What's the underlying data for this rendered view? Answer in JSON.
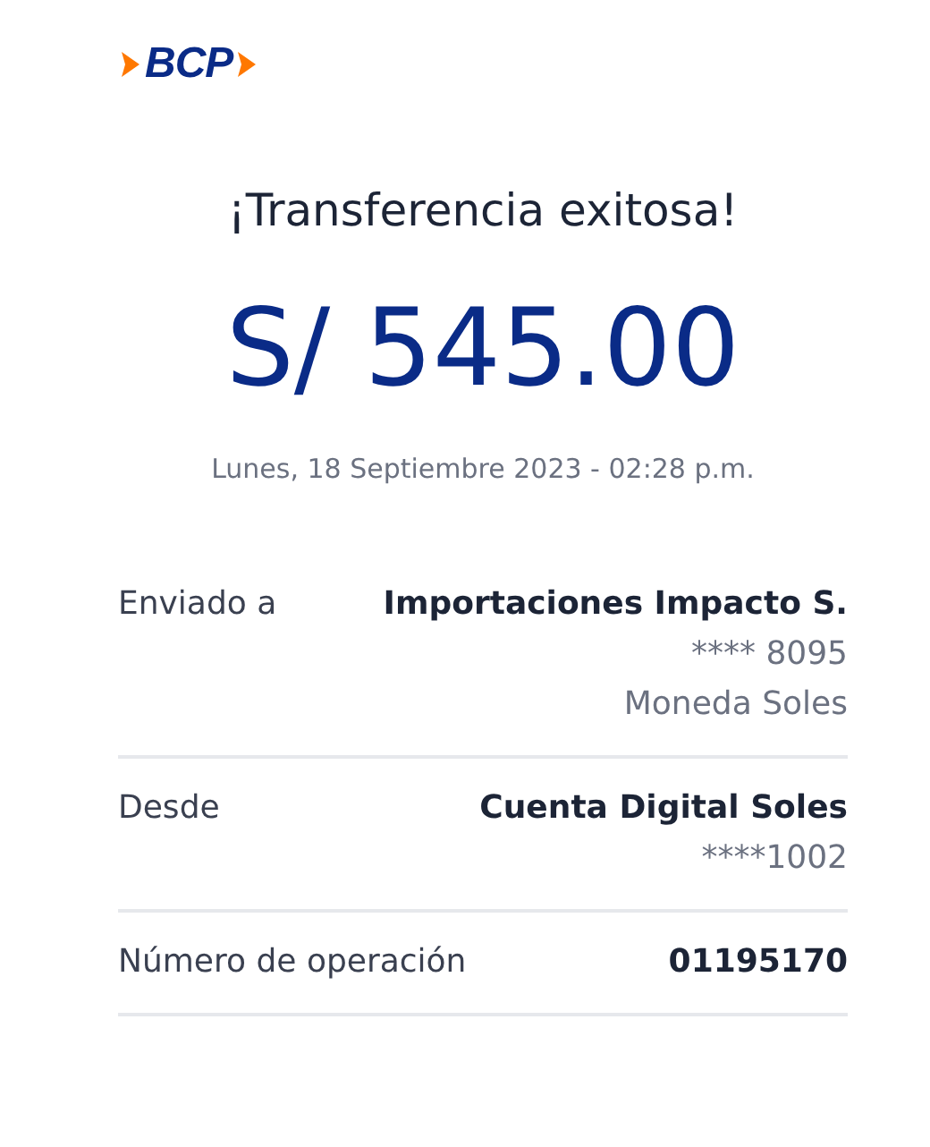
{
  "logo": {
    "text": "BCP"
  },
  "title": "¡Transferencia exitosa!",
  "amount": "S/ 545.00",
  "date": "Lunes, 18 Septiembre 2023 - 02:28 p.m.",
  "details": [
    {
      "label": "Enviado a",
      "lines": [
        "Importaciones Impacto S.",
        "**** 8095",
        "Moneda Soles"
      ]
    },
    {
      "label": "Desde",
      "lines": [
        "Cuenta Digital Soles",
        "****1002"
      ]
    },
    {
      "label": "Número de operación",
      "lines": [
        "01195170"
      ]
    }
  ]
}
